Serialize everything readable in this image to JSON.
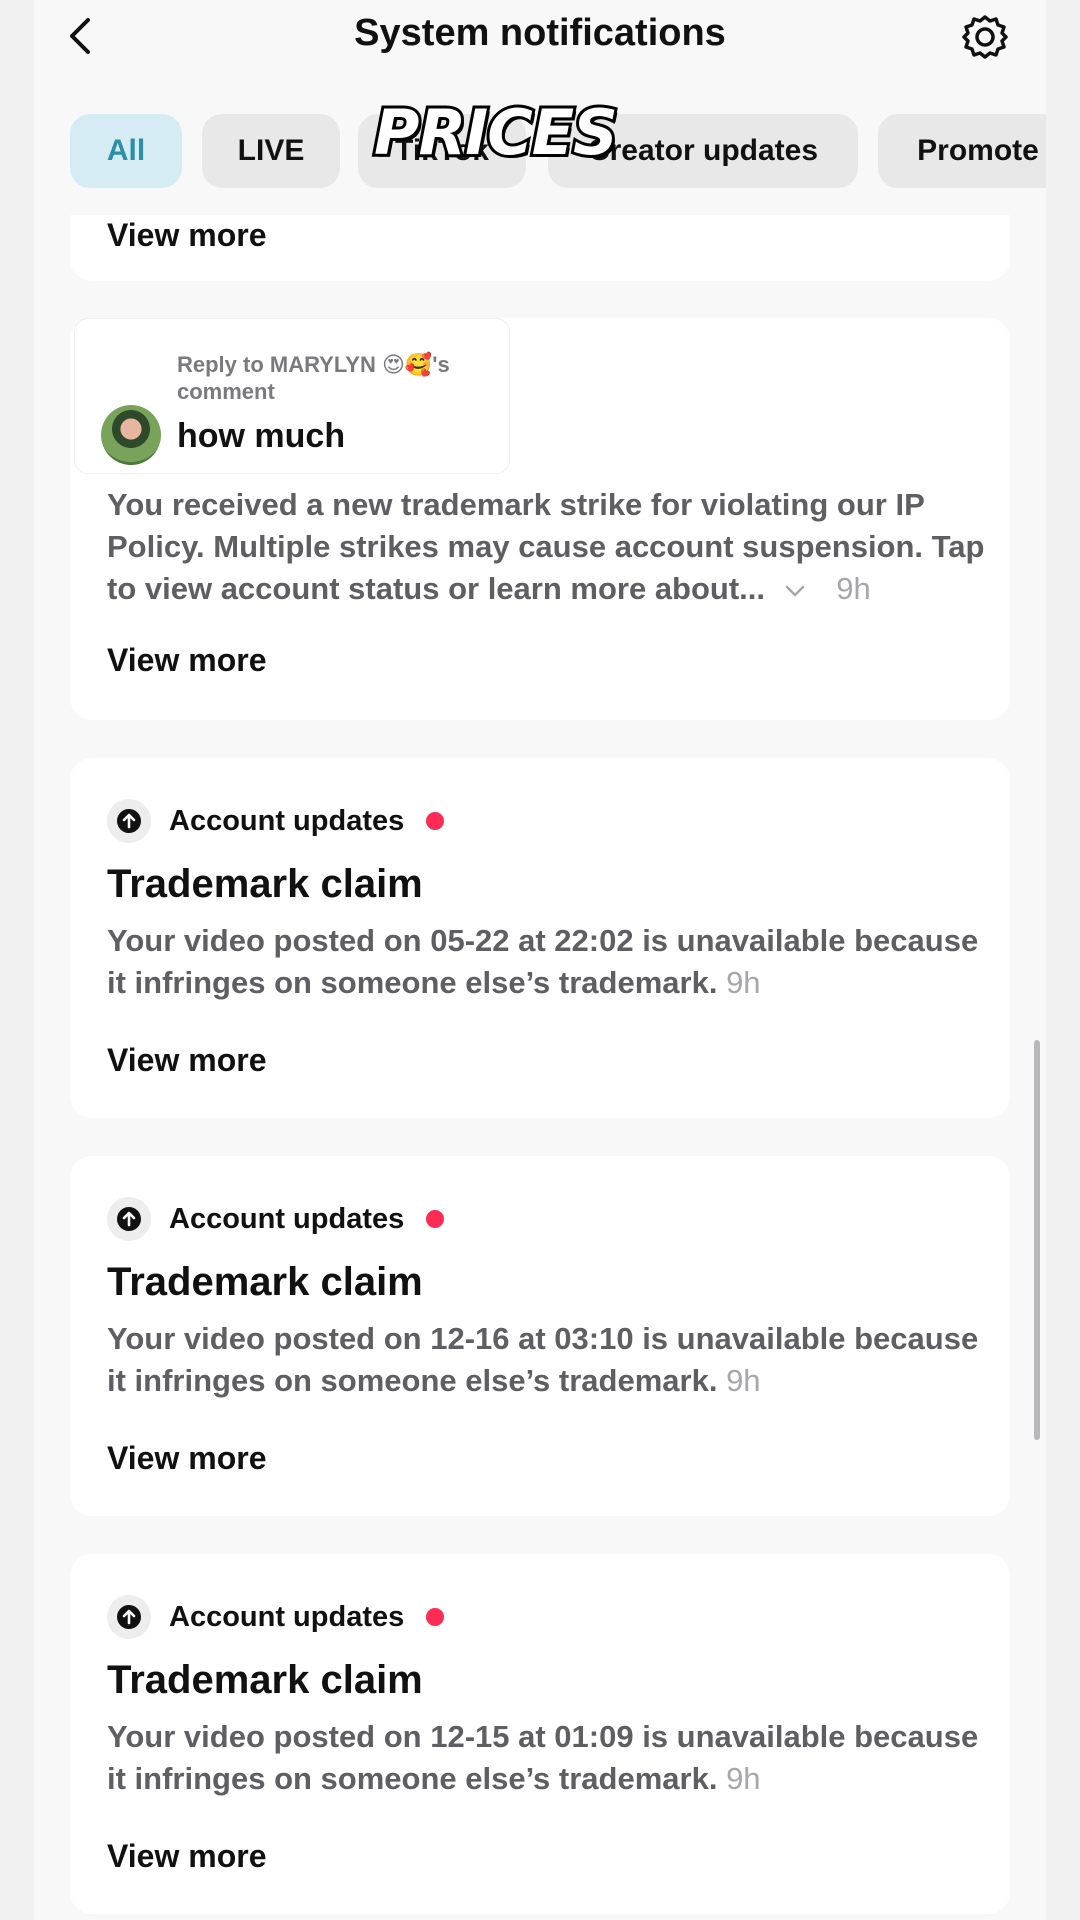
{
  "header": {
    "title": "System notifications",
    "back_icon": "chevron-left-icon",
    "settings_icon": "gear-icon"
  },
  "tabs": [
    {
      "label": "All",
      "active": true
    },
    {
      "label": "LIVE",
      "active": false
    },
    {
      "label": "TikTok",
      "active": false
    },
    {
      "label": "Creator updates",
      "active": false
    },
    {
      "label": "Promote",
      "active": false
    }
  ],
  "overlay_text": "PRICES",
  "top_card": {
    "view_more": "View more"
  },
  "strike_card": {
    "reply_to": "Reply to MARYLYN 😍🥰's comment",
    "comment": "how much",
    "body": "You received a new trademark strike for violating our IP Policy. Multiple strikes may cause account suspension. Tap to view account status or learn more about...",
    "time": "9h",
    "view_more": "View more"
  },
  "claims": [
    {
      "category": "Account updates",
      "title": "Trademark claim",
      "body": "Your video posted on 05-22 at 22:02 is unavailable because it infringes on someone else’s trademark.",
      "time": "9h",
      "view_more": "View more"
    },
    {
      "category": "Account updates",
      "title": "Trademark claim",
      "body": "Your video posted on 12-16 at 03:10 is unavailable because it infringes on someone else’s trademark.",
      "time": "9h",
      "view_more": "View more"
    },
    {
      "category": "Account updates",
      "title": "Trademark claim",
      "body": "Your video posted on 12-15 at 01:09 is unavailable because it infringes on someone else’s trademark.",
      "time": "9h",
      "view_more": "View more"
    }
  ],
  "colors": {
    "accent_tab_bg": "#d5ecf4",
    "accent_tab_text": "#2a8fa7",
    "unread_dot": "#fe2c55"
  }
}
